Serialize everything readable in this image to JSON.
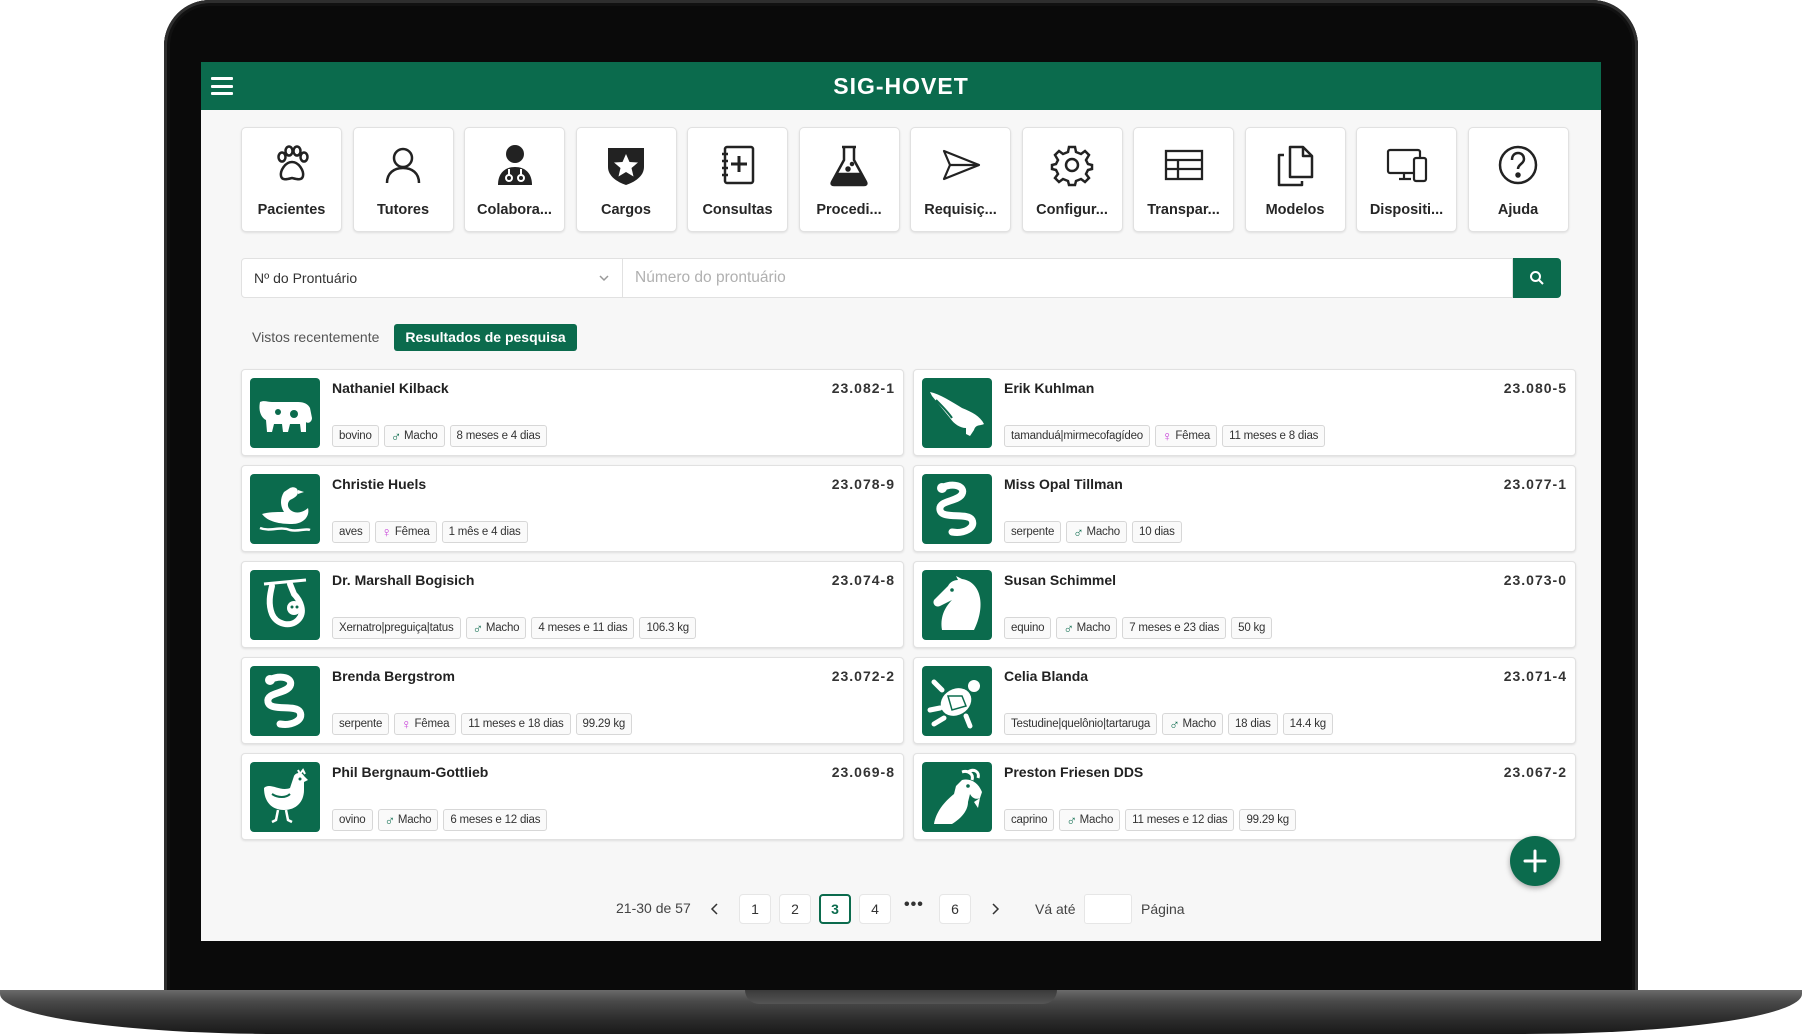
{
  "app": {
    "title": "SIG-HOVET"
  },
  "modules": [
    {
      "label": "Pacientes",
      "icon": "paw-icon"
    },
    {
      "label": "Tutores",
      "icon": "user-icon"
    },
    {
      "label": "Colabora...",
      "icon": "doctor-icon"
    },
    {
      "label": "Cargos",
      "icon": "star-badge-icon"
    },
    {
      "label": "Consultas",
      "icon": "medical-book-icon"
    },
    {
      "label": "Procedi...",
      "icon": "flask-icon"
    },
    {
      "label": "Requisiç...",
      "icon": "send-icon"
    },
    {
      "label": "Configur...",
      "icon": "gear-icon"
    },
    {
      "label": "Transpar...",
      "icon": "table-icon"
    },
    {
      "label": "Modelos",
      "icon": "documents-icon"
    },
    {
      "label": "Dispositi...",
      "icon": "devices-icon"
    },
    {
      "label": "Ajuda",
      "icon": "help-icon"
    }
  ],
  "search": {
    "field_selected": "Nº do Prontuário",
    "placeholder": "Número do prontuário"
  },
  "tabs": [
    {
      "label": "Vistos recentemente",
      "active": false
    },
    {
      "label": "Resultados de pesquisa",
      "active": true
    }
  ],
  "patients": [
    {
      "name": "Nathaniel Kilback",
      "id": "23.082-1",
      "species": "bovino",
      "sex": "Macho",
      "sex_symbol": "♂",
      "age": "8 meses e 4 dias",
      "weight": "",
      "icon": "cow-icon"
    },
    {
      "name": "Erik Kuhlman",
      "id": "23.080-5",
      "species": "tamanduá|mirmecofagídeo",
      "sex": "Fêmea",
      "sex_symbol": "♀",
      "age": "11 meses e 8 dias",
      "weight": "",
      "icon": "anteater-icon"
    },
    {
      "name": "Christie Huels",
      "id": "23.078-9",
      "species": "aves",
      "sex": "Fêmea",
      "sex_symbol": "♀",
      "age": "1 mês e 4 dias",
      "weight": "",
      "icon": "swan-icon"
    },
    {
      "name": "Miss Opal Tillman",
      "id": "23.077-1",
      "species": "serpente",
      "sex": "Macho",
      "sex_symbol": "♂",
      "age": "10 dias",
      "weight": "",
      "icon": "snake-icon"
    },
    {
      "name": "Dr. Marshall Bogisich",
      "id": "23.074-8",
      "species": "Xernatro|preguiça|tatus",
      "sex": "Macho",
      "sex_symbol": "♂",
      "age": "4 meses e 11 dias",
      "weight": "106.3 kg",
      "icon": "sloth-icon"
    },
    {
      "name": "Susan Schimmel",
      "id": "23.073-0",
      "species": "equino",
      "sex": "Macho",
      "sex_symbol": "♂",
      "age": "7 meses e 23 dias",
      "weight": "50 kg",
      "icon": "horse-icon"
    },
    {
      "name": "Brenda Bergstrom",
      "id": "23.072-2",
      "species": "serpente",
      "sex": "Fêmea",
      "sex_symbol": "♀",
      "age": "11 meses e 18 dias",
      "weight": "99.29 kg",
      "icon": "snake-icon"
    },
    {
      "name": "Celia Blanda",
      "id": "23.071-4",
      "species": "Testudine|quelônio|tartaruga",
      "sex": "Macho",
      "sex_symbol": "♂",
      "age": "18 dias",
      "weight": "14.4 kg",
      "icon": "turtle-icon"
    },
    {
      "name": "Phil Bergnaum-Gottlieb",
      "id": "23.069-8",
      "species": "ovino",
      "sex": "Macho",
      "sex_symbol": "♂",
      "age": "6 meses e 12 dias",
      "weight": "",
      "icon": "chicken-icon"
    },
    {
      "name": "Preston Friesen DDS",
      "id": "23.067-2",
      "species": "caprino",
      "sex": "Macho",
      "sex_symbol": "♂",
      "age": "11 meses e 12 dias",
      "weight": "99.29 kg",
      "icon": "goat-icon"
    }
  ],
  "pagination": {
    "range": "21-30 de 57",
    "pages": [
      "1",
      "2",
      "3",
      "4",
      "6"
    ],
    "current": "3",
    "ellipsis": "•••",
    "goto_label": "Vá até",
    "page_label": "Página"
  },
  "colors": {
    "primary": "#0b6b4d",
    "female": "#c63bd8"
  }
}
